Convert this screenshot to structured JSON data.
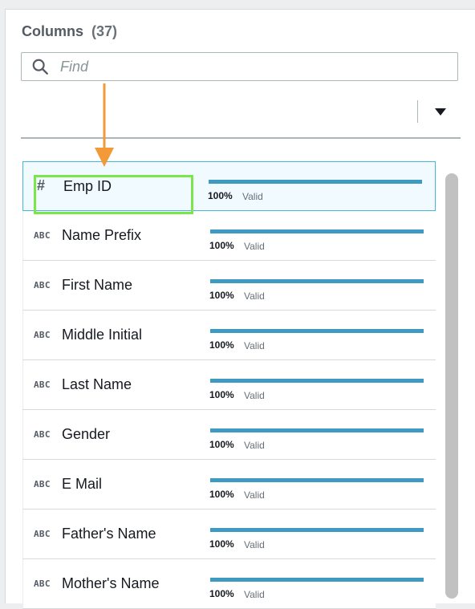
{
  "panel": {
    "title": "Columns",
    "count": "(37)",
    "search": {
      "placeholder": "Find",
      "icon": "search-icon"
    }
  },
  "columns": [
    {
      "type_icon": "#",
      "name": "Emp ID",
      "valid_pct": 100,
      "pct_label": "100%",
      "status": "Valid",
      "selected": true
    },
    {
      "type_icon": "ABC",
      "name": "Name Prefix",
      "valid_pct": 100,
      "pct_label": "100%",
      "status": "Valid"
    },
    {
      "type_icon": "ABC",
      "name": "First Name",
      "valid_pct": 100,
      "pct_label": "100%",
      "status": "Valid"
    },
    {
      "type_icon": "ABC",
      "name": "Middle Initial",
      "valid_pct": 100,
      "pct_label": "100%",
      "status": "Valid"
    },
    {
      "type_icon": "ABC",
      "name": "Last Name",
      "valid_pct": 100,
      "pct_label": "100%",
      "status": "Valid"
    },
    {
      "type_icon": "ABC",
      "name": "Gender",
      "valid_pct": 100,
      "pct_label": "100%",
      "status": "Valid"
    },
    {
      "type_icon": "ABC",
      "name": "E Mail",
      "valid_pct": 100,
      "pct_label": "100%",
      "status": "Valid"
    },
    {
      "type_icon": "ABC",
      "name": "Father's Name",
      "valid_pct": 100,
      "pct_label": "100%",
      "status": "Valid"
    },
    {
      "type_icon": "ABC",
      "name": "Mother's Name",
      "valid_pct": 100,
      "pct_label": "100%",
      "status": "Valid"
    }
  ],
  "colors": {
    "bar_fill": "#3f9ac2",
    "selected_border": "#44b9d6",
    "highlight": "#7ae649",
    "arrow": "#f29a38"
  }
}
